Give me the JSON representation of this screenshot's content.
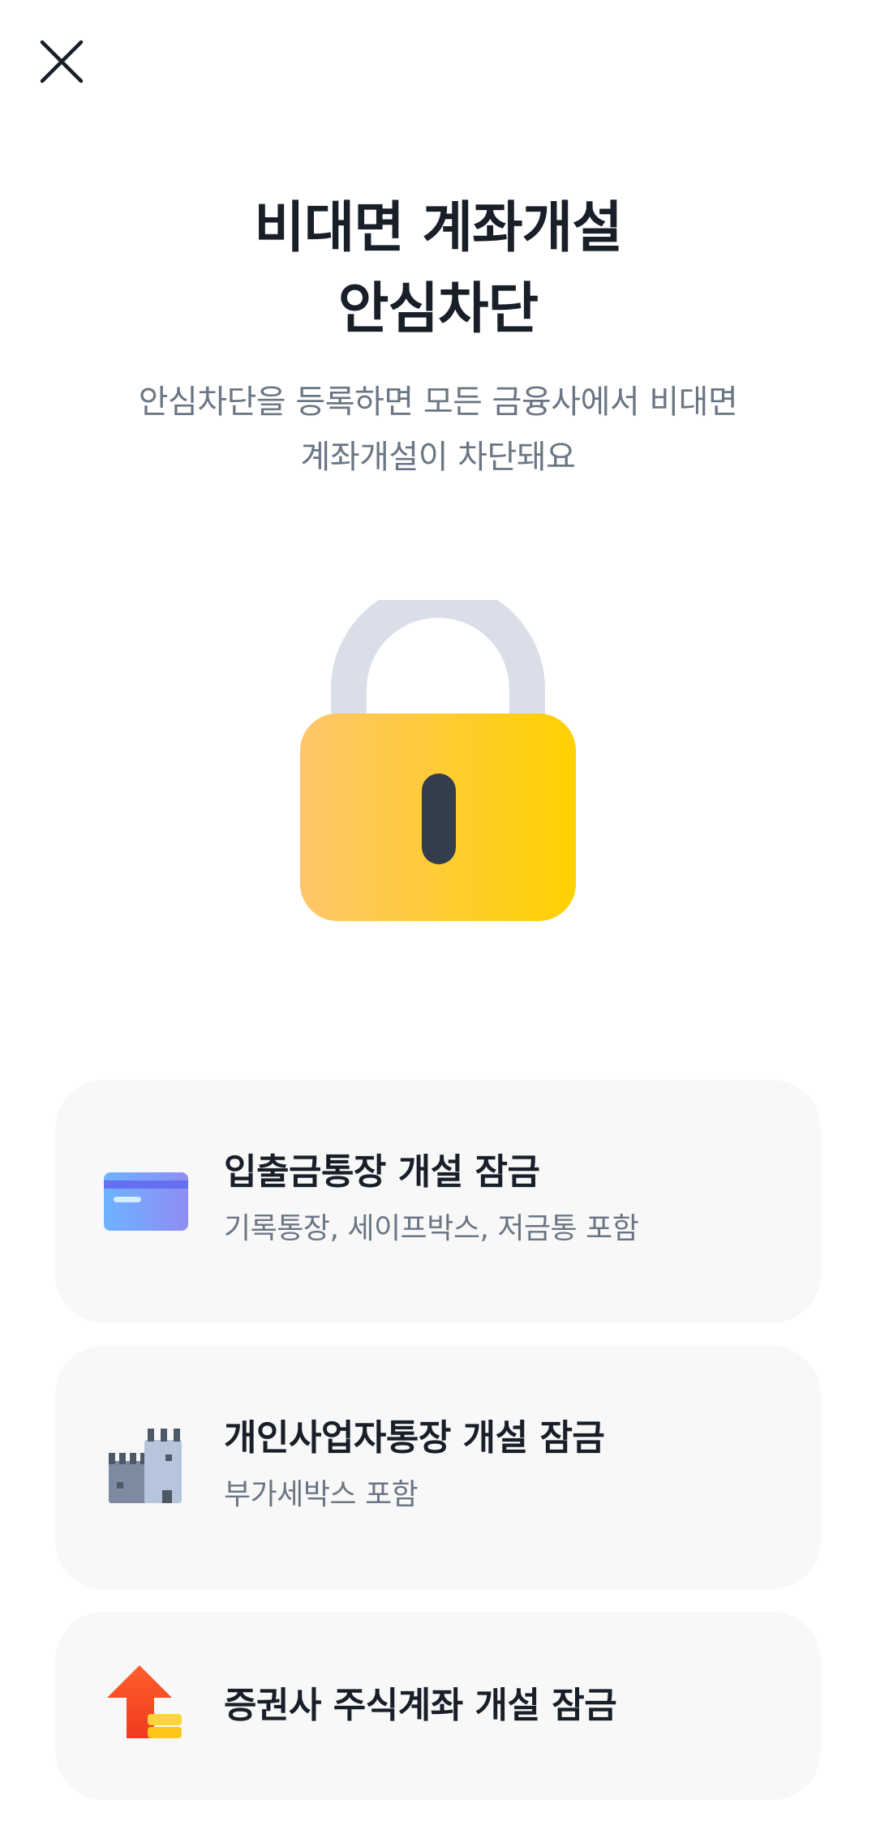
{
  "header": {
    "close_icon": "close-icon"
  },
  "hero": {
    "title_line1": "비대면 계좌개설",
    "title_line2": "안심차단",
    "subtitle_line1": "안심차단을 등록하면 모든 금융사에서 비대면",
    "subtitle_line2": "계좌개설이 차단돼요",
    "illustration": "padlock-icon"
  },
  "options": [
    {
      "icon": "credit-card-icon",
      "title": "입출금통장 개설 잠금",
      "description": "기록통장, 세이프박스, 저금통 포함"
    },
    {
      "icon": "building-icon",
      "title": "개인사업자통장 개설 잠금",
      "description": "부가세박스 포함"
    },
    {
      "icon": "stock-up-arrow-icon",
      "title": "증권사 주식계좌 개설 잠금",
      "description": ""
    }
  ],
  "colors": {
    "title": "#191f28",
    "subtitle": "#6b7684",
    "card_background": "#f8f8f9",
    "lock_body_start": "#ffc56b",
    "lock_body_end": "#ffd100",
    "lock_shackle": "#d9dee9",
    "keyhole": "#333d4b"
  }
}
